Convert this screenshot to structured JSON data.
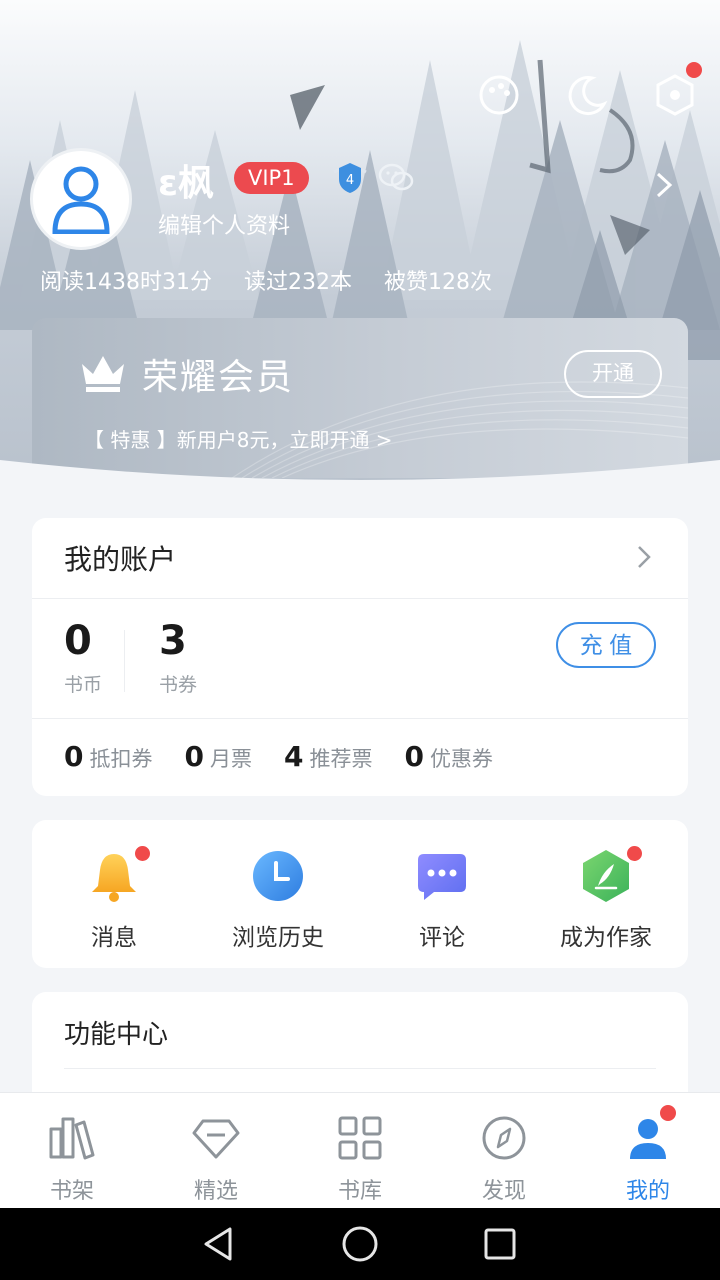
{
  "profile": {
    "name": "ε枫",
    "vip_badge": "VIP1",
    "level": "4",
    "edit_link": "编辑个人资料"
  },
  "stats": {
    "reading_time": "阅读1438时31分",
    "books_read": "读过232本",
    "likes": "被赞128次"
  },
  "vip_card": {
    "title": "荣耀会员",
    "open_button": "开通",
    "promo": "【 特惠 】新用户8元，立即开通 >"
  },
  "account": {
    "title": "我的账户",
    "coins_value": "0",
    "coins_label": "书币",
    "vouchers_value": "3",
    "vouchers_label": "书券",
    "recharge_button": "充 值",
    "tickets": [
      {
        "value": "0",
        "label": "抵扣券"
      },
      {
        "value": "0",
        "label": "月票"
      },
      {
        "value": "4",
        "label": "推荐票"
      },
      {
        "value": "0",
        "label": "优惠券"
      }
    ]
  },
  "quick_actions": [
    {
      "label": "消息",
      "icon": "bell-icon"
    },
    {
      "label": "浏览历史",
      "icon": "clock-icon"
    },
    {
      "label": "评论",
      "icon": "chat-bubble-icon"
    },
    {
      "label": "成为作家",
      "icon": "pen-hexagon-icon"
    }
  ],
  "function_center": {
    "title": "功能中心"
  },
  "bottom_nav": [
    {
      "label": "书架",
      "icon": "bookshelf-icon"
    },
    {
      "label": "精选",
      "icon": "diamond-icon"
    },
    {
      "label": "书库",
      "icon": "grid-icon"
    },
    {
      "label": "发现",
      "icon": "compass-icon"
    },
    {
      "label": "我的",
      "icon": "person-icon",
      "active": true
    }
  ],
  "colors": {
    "accent_blue": "#2e86e8",
    "vip_red": "#ec4a4f",
    "notification_red": "#f04a4a"
  }
}
